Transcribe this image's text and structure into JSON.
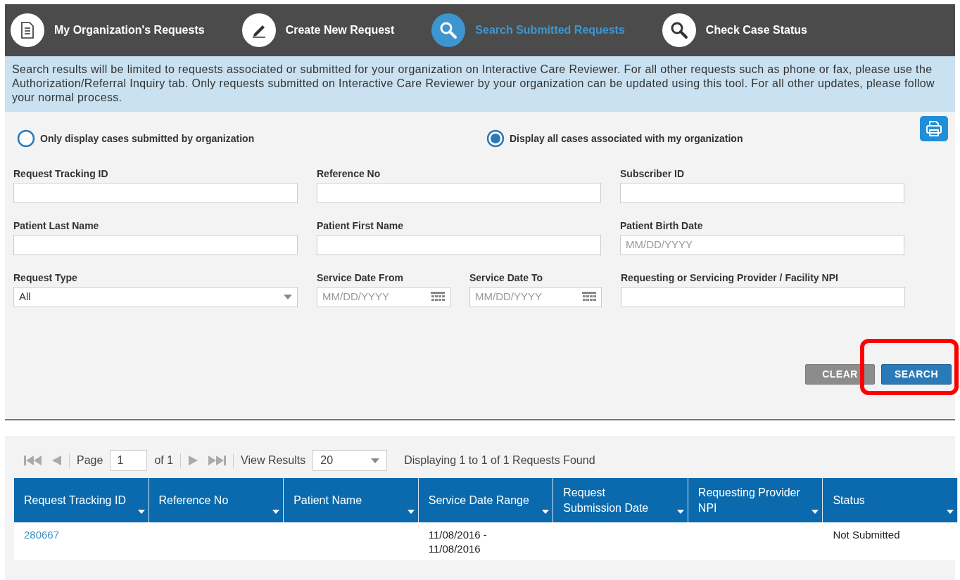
{
  "nav": [
    {
      "label": "My Organization's Requests",
      "kind": "document",
      "selected": false
    },
    {
      "label": "Create New Request",
      "kind": "pencil",
      "selected": false
    },
    {
      "label": "Search Submitted Requests",
      "kind": "search",
      "selected": true
    },
    {
      "label": "Check Case Status",
      "kind": "search",
      "selected": false
    }
  ],
  "notice": "Search results will be limited to requests associated or submitted for your organization on Interactive Care Reviewer. For all other requests such as phone or fax, please use the Authorization/Referral Inquiry tab. Only requests submitted on Interactive Care Reviewer by your organization can be updated using this tool. For all other updates, please follow your normal process.",
  "radios": [
    {
      "label": "Only display cases submitted by organization",
      "selected": false
    },
    {
      "label": "Display all cases associated with my organization",
      "selected": true
    }
  ],
  "form_rows": [
    [
      {
        "label": "Request Tracking ID",
        "kind": "text"
      },
      {
        "label": "Reference No",
        "kind": "text"
      },
      {
        "label": "Subscriber ID",
        "kind": "text"
      }
    ],
    [
      {
        "label": "Patient Last Name",
        "kind": "text"
      },
      {
        "label": "Patient First Name",
        "kind": "text"
      },
      {
        "label": "Patient Birth Date",
        "kind": "text",
        "placeholder": "MM/DD/YYYY"
      }
    ],
    [
      {
        "label": "Request Type",
        "kind": "select",
        "value": "All"
      },
      {
        "label": "Service Date From",
        "kind": "date",
        "placeholder": "MM/DD/YYYY"
      },
      {
        "label": "Service Date To",
        "kind": "date",
        "placeholder": "MM/DD/YYYY"
      },
      {
        "label": "Requesting or Servicing Provider / Facility NPI",
        "kind": "text"
      }
    ]
  ],
  "buttons": [
    {
      "label": "CLEAR",
      "kind": "secondary",
      "highlighted": false
    },
    {
      "label": "SEARCH",
      "kind": "primary",
      "highlighted": true
    }
  ],
  "pager": {
    "page_label": "Page",
    "page": "1",
    "of": "of 1",
    "view_label": "View Results",
    "page_size": "20",
    "summary": "Displaying 1 to 1 of 1 Requests Found"
  },
  "table": {
    "columns": [
      "Request Tracking ID",
      "Reference No",
      "Patient Name",
      "Service Date Range",
      "Request Submission Date",
      "Requesting Provider NPI",
      "Status"
    ],
    "rows": [
      [
        {
          "text": "280667",
          "kind": "link"
        },
        {},
        {},
        {
          "text": "11/08/2016 - 11/08/2016"
        },
        {},
        {},
        {
          "text": "Not Submitted"
        }
      ]
    ]
  }
}
